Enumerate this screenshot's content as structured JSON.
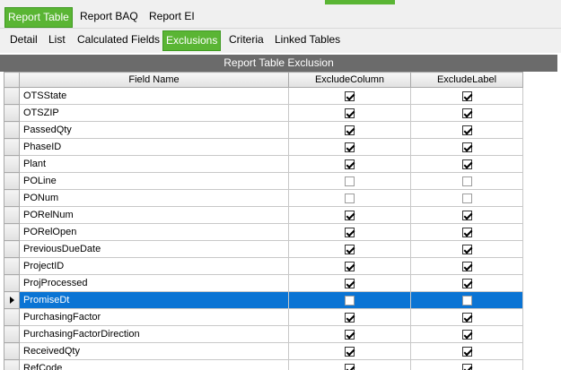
{
  "tabs_primary": [
    "Report Table",
    "Report BAQ",
    "Report EI"
  ],
  "tabs_secondary": [
    "Detail",
    "List",
    "Calculated Fields",
    "Exclusions",
    "Criteria",
    "Linked Tables"
  ],
  "grid": {
    "caption": "Report Table Exclusion",
    "columns": [
      "Field Name",
      "ExcludeColumn",
      "ExcludeLabel"
    ],
    "rows": [
      {
        "field": "OTSState",
        "exclude_column": true,
        "exclude_label": true
      },
      {
        "field": "OTSZIP",
        "exclude_column": true,
        "exclude_label": true
      },
      {
        "field": "PassedQty",
        "exclude_column": true,
        "exclude_label": true
      },
      {
        "field": "PhaseID",
        "exclude_column": true,
        "exclude_label": true
      },
      {
        "field": "Plant",
        "exclude_column": true,
        "exclude_label": true
      },
      {
        "field": "POLine",
        "exclude_column": false,
        "exclude_label": false
      },
      {
        "field": "PONum",
        "exclude_column": false,
        "exclude_label": false
      },
      {
        "field": "PORelNum",
        "exclude_column": true,
        "exclude_label": true
      },
      {
        "field": "PORelOpen",
        "exclude_column": true,
        "exclude_label": true
      },
      {
        "field": "PreviousDueDate",
        "exclude_column": true,
        "exclude_label": true
      },
      {
        "field": "ProjectID",
        "exclude_column": true,
        "exclude_label": true
      },
      {
        "field": "ProjProcessed",
        "exclude_column": true,
        "exclude_label": true
      },
      {
        "field": "PromiseDt",
        "exclude_column": false,
        "exclude_label": false,
        "selected": true
      },
      {
        "field": "PurchasingFactor",
        "exclude_column": true,
        "exclude_label": true
      },
      {
        "field": "PurchasingFactorDirection",
        "exclude_column": true,
        "exclude_label": true
      },
      {
        "field": "ReceivedQty",
        "exclude_column": true,
        "exclude_label": true
      },
      {
        "field": "RefCode",
        "exclude_column": true,
        "exclude_label": true
      }
    ]
  },
  "colors": {
    "active_tab": "#5ab534",
    "selected_row": "#0a74d4",
    "caption_bar": "#6b6b6b"
  }
}
